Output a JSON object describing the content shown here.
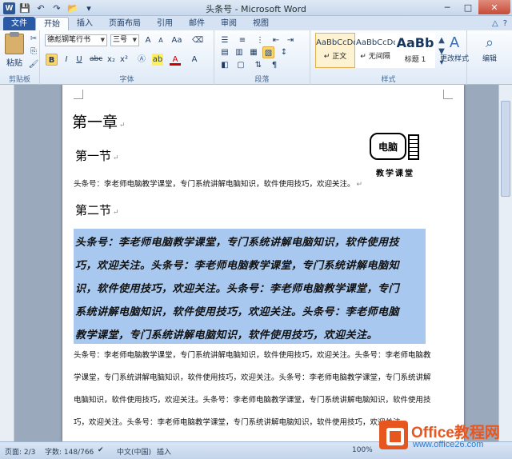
{
  "window": {
    "title": "头条号 - Microsoft Word",
    "app_icon": "W"
  },
  "tabs": [
    "文件",
    "开始",
    "插入",
    "页面布局",
    "引用",
    "邮件",
    "审阅",
    "视图"
  ],
  "active_tab": "开始",
  "ribbon": {
    "clipboard": {
      "label": "剪贴板",
      "paste": "粘贴"
    },
    "font": {
      "label": "字体",
      "font_name": "德彪钢笔行书",
      "font_size": "三号",
      "bold": "B",
      "italic": "I",
      "underline": "U",
      "strike": "abc",
      "sub": "x₂",
      "sup": "x²",
      "clear": "Aa",
      "grow": "A",
      "shrink": "A",
      "color_letter": "A"
    },
    "paragraph": {
      "label": "段落"
    },
    "styles": {
      "label": "样式",
      "items": [
        {
          "sample": "AaBbCcDd",
          "name": "↵ 正文",
          "selected": true
        },
        {
          "sample": "AaBbCcDd",
          "name": "↵ 无间隔",
          "selected": false
        },
        {
          "sample": "AaBb",
          "name": "标题 1",
          "selected": false
        }
      ],
      "change_styles": "更改样式"
    },
    "editing": {
      "label": "编辑"
    }
  },
  "document": {
    "chapter": "第一章",
    "section1": "第一节",
    "section2": "第二节",
    "para1": "头条号：李老师电脑教学课堂，专门系统讲解电脑知识，软件使用技巧，欢迎关注。",
    "logo": {
      "screen_text": "电脑",
      "caption": "教学课堂"
    },
    "selected_lines": [
      "头条号：李老师电脑教学课堂，专门系统讲解电脑知识，软件使用技",
      "巧，欢迎关注。头条号：李老师电脑教学课堂，专门系统讲解电脑知",
      "识，软件使用技巧，欢迎关注。头条号：李老师电脑教学课堂，专门",
      "系统讲解电脑知识，软件使用技巧，欢迎关注。头条号：李老师电脑",
      "教学课堂，专门系统讲解电脑知识，软件使用技巧，欢迎关注。"
    ],
    "normal_lines": [
      "头条号：李老师电脑教学课堂，专门系统讲解电脑知识，软件使用技巧，欢迎关注。头条号：李老师电脑教",
      "学课堂，专门系统讲解电脑知识，软件使用技巧，欢迎关注。头条号：李老师电脑教学课堂，专门系统讲解",
      "电脑知识，软件使用技巧，欢迎关注。头条号：李老师电脑教学课堂，专门系统讲解电脑知识，软件使用技",
      "巧，欢迎关注。头条号：李老师电脑教学课堂，专门系统讲解电脑知识，软件使用技巧，欢迎关注。"
    ]
  },
  "status": {
    "page": "页面: 2/3",
    "words": "字数: 148/766",
    "lang": "中文(中国)",
    "mode": "插入",
    "zoom": "100%"
  },
  "watermark": {
    "name": "Office教程网",
    "url": "www.office26.com"
  }
}
